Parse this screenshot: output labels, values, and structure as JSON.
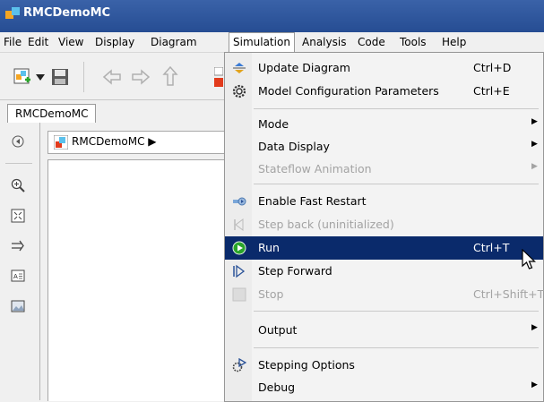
{
  "window": {
    "title": "RMCDemoMC"
  },
  "menubar": [
    "File",
    "Edit",
    "View",
    "Display",
    "Diagram",
    "Simulation",
    "Analysis",
    "Code",
    "Tools",
    "Help"
  ],
  "tab": {
    "label": "RMCDemoMC"
  },
  "address": {
    "crumb": "RMCDemoMC ▶"
  },
  "simulation_menu": {
    "update_diagram": {
      "label": "Update Diagram",
      "shortcut": "Ctrl+D"
    },
    "model_config": {
      "label": "Model Configuration Parameters",
      "shortcut": "Ctrl+E"
    },
    "mode": {
      "label": "Mode"
    },
    "data_display": {
      "label": "Data Display"
    },
    "stateflow_animation": {
      "label": "Stateflow Animation"
    },
    "fast_restart": {
      "label": "Enable Fast Restart"
    },
    "step_back": {
      "label": "Step back (uninitialized)"
    },
    "run": {
      "label": "Run",
      "shortcut": "Ctrl+T"
    },
    "step_forward": {
      "label": "Step Forward"
    },
    "stop": {
      "label": "Stop",
      "shortcut": "Ctrl+Shift+T"
    },
    "output": {
      "label": "Output"
    },
    "stepping_options": {
      "label": "Stepping Options"
    },
    "debug": {
      "label": "Debug"
    }
  },
  "colors": {
    "title_bar": "#2a5298",
    "highlight": "#0a2a6b",
    "run_icon": "#2aa52a"
  }
}
